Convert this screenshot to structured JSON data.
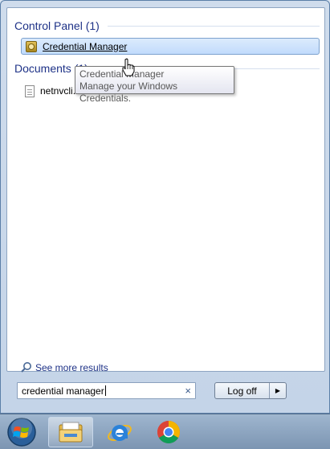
{
  "groups": {
    "control_panel": {
      "title": "Control Panel (1)"
    },
    "documents": {
      "title": "Documents (1)"
    }
  },
  "results": {
    "credential_manager": {
      "label": "Credential Manager",
      "icon": "credential-manager-icon"
    },
    "netnvcli": {
      "label": "netnvcli.inf",
      "icon": "document-icon"
    }
  },
  "tooltip": {
    "title": "Credential Manager",
    "description": "Manage your Windows Credentials."
  },
  "see_more": {
    "label": "See more results"
  },
  "search": {
    "value": "credential manager",
    "clear_icon": "×"
  },
  "power": {
    "label": "Log off",
    "arrow": "▶"
  },
  "taskbar": {
    "items": [
      "start-orb",
      "windows-explorer",
      "internet-explorer",
      "google-chrome"
    ]
  },
  "colors": {
    "accent": "#1e3287",
    "selection": "#c1dbfc"
  }
}
